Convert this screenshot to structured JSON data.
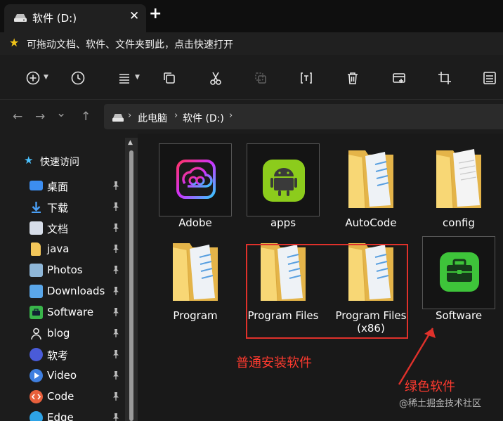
{
  "window": {
    "tab_title": "软件 (D:)",
    "close_glyph": "✕",
    "new_tab_glyph": "+"
  },
  "tip_bar": {
    "text": "可拖动文档、软件、文件夹到此，点击快速打开"
  },
  "toolbar": {
    "icons": [
      "new-icon",
      "recent-icon",
      "view-icon",
      "copy-icon",
      "cut-icon",
      "paste-icon",
      "rename-icon",
      "delete-icon",
      "new-tab-icon",
      "crop-icon",
      "properties-icon"
    ]
  },
  "address": {
    "back_glyph": "←",
    "forward_glyph": "→",
    "history_glyph": "⌄",
    "up_glyph": "↑",
    "crumbs": [
      "此电脑",
      "软件 (D:)"
    ],
    "sep_glyph": "›"
  },
  "sidebar": {
    "quick_access": "快速访问",
    "items": [
      {
        "label": "桌面",
        "icon": "desktop-icon",
        "color": "#3c8df0"
      },
      {
        "label": "下载",
        "icon": "download-icon",
        "color": "#4a9ff5"
      },
      {
        "label": "文档",
        "icon": "document-icon",
        "color": "#d6dde8"
      },
      {
        "label": "java",
        "icon": "folder-icon",
        "color": "#f3c75a"
      },
      {
        "label": "Photos",
        "icon": "photos-icon",
        "color": "#8fb7d8"
      },
      {
        "label": "Downloads",
        "icon": "downloads-icon",
        "color": "#5aa6e8"
      },
      {
        "label": "Software",
        "icon": "software-icon",
        "color": "#39b54a"
      },
      {
        "label": "blog",
        "icon": "blog-icon",
        "color": "#e8e8e8"
      },
      {
        "label": "软考",
        "icon": "exam-icon",
        "color": "#4a5bd8"
      },
      {
        "label": "Video",
        "icon": "video-icon",
        "color": "#3f7fe0"
      },
      {
        "label": "Code",
        "icon": "code-icon",
        "color": "#e8603c"
      },
      {
        "label": "Edge",
        "icon": "edge-icon",
        "color": "#2ea3e6"
      }
    ]
  },
  "files": [
    {
      "label": "Adobe",
      "kind": "adobe"
    },
    {
      "label": "apps",
      "kind": "android"
    },
    {
      "label": "AutoCode",
      "kind": "folder"
    },
    {
      "label": "config",
      "kind": "folder-doc"
    },
    {
      "label": "Program",
      "kind": "folder"
    },
    {
      "label": "Program Files",
      "kind": "folder"
    },
    {
      "label": "Program Files",
      "label2": "(x86)",
      "kind": "folder"
    },
    {
      "label": "Software",
      "kind": "toolbox"
    }
  ],
  "annotations": {
    "normal": "普通安装软件",
    "green": "绿色软件",
    "watermark": "@稀土掘金技术社区",
    "color": "#e0312b"
  }
}
